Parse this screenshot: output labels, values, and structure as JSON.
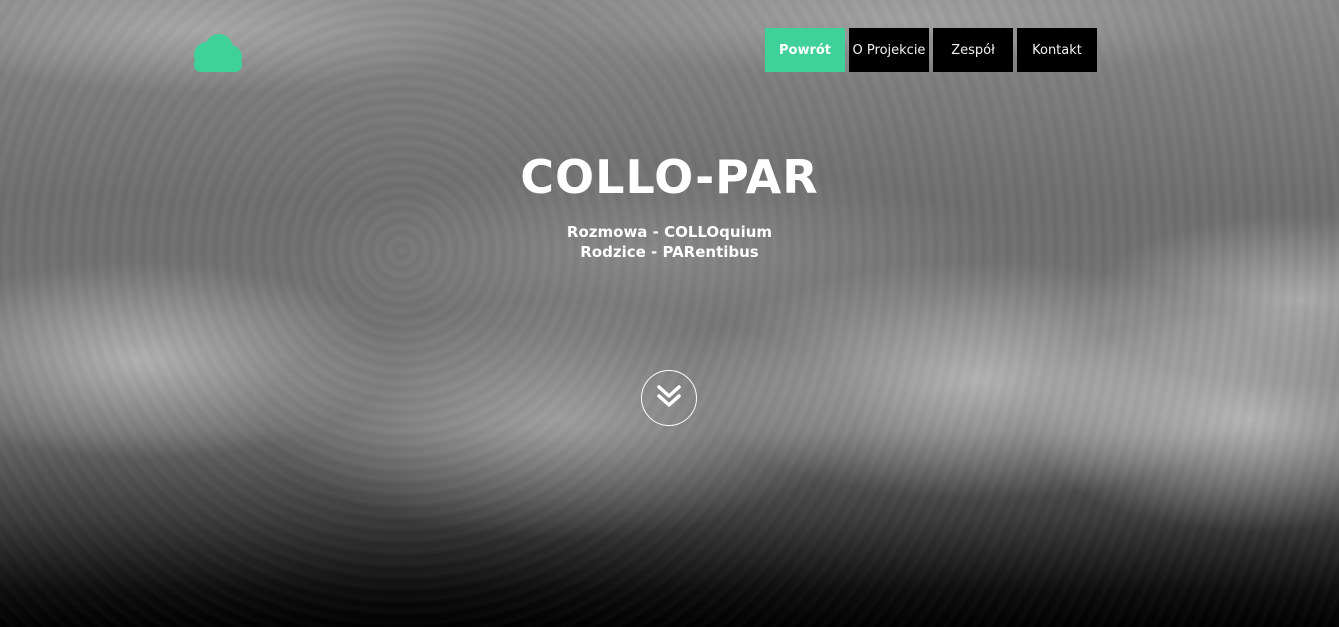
{
  "nav": {
    "items": [
      {
        "label": "Powrót",
        "active": true
      },
      {
        "label": "O Projekcie",
        "active": false
      },
      {
        "label": "Zespół",
        "active": false
      },
      {
        "label": "Kontakt",
        "active": false
      }
    ]
  },
  "hero": {
    "title": "COLLO-PAR",
    "subtitle_line1": "Rozmowa - COLLOquium",
    "subtitle_line2": "Rodzice - PARentibus"
  },
  "icons": {
    "logo": "cloud-icon",
    "scroll": "double-chevron-down-icon"
  },
  "colors": {
    "accent": "#3fd19a",
    "nav_background": "#000000",
    "text": "#ffffff"
  }
}
